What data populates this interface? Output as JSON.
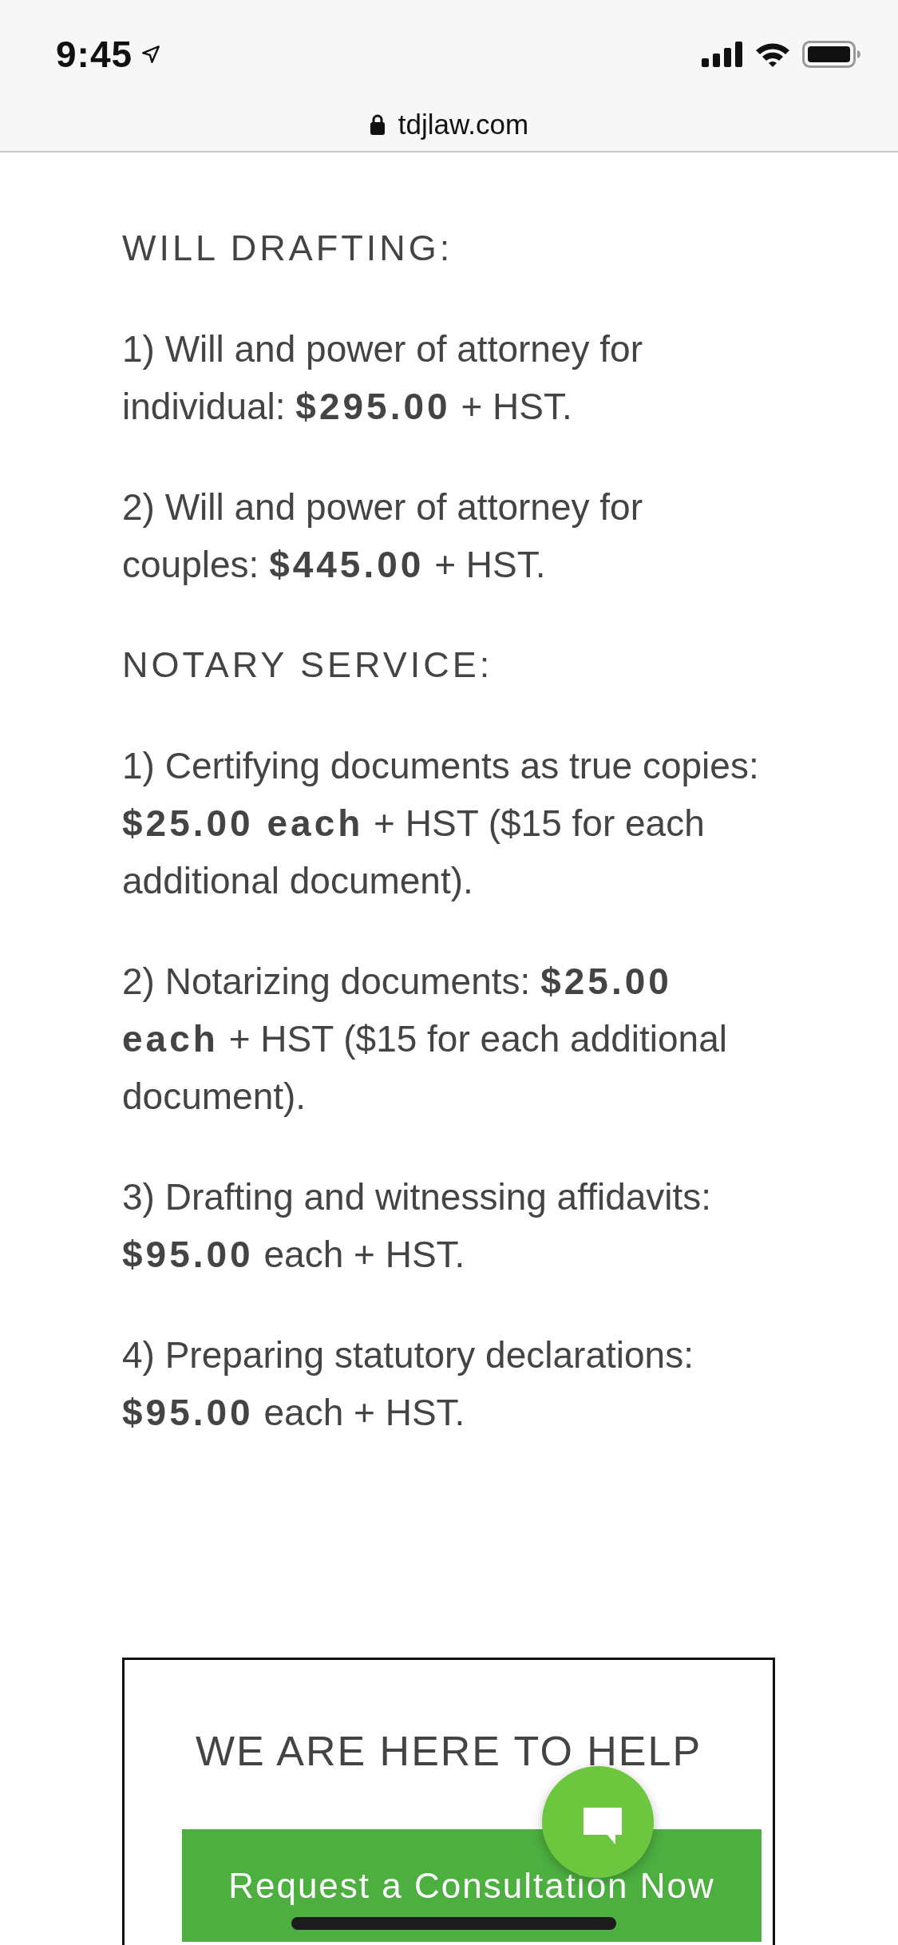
{
  "status_bar": {
    "time": "9:45"
  },
  "browser": {
    "url": "tdjlaw.com",
    "secure": true
  },
  "sections": [
    {
      "heading": "WILL DRAFTING:",
      "items": [
        "1) Will and power of attorney for individual: **$295.00** + HST.",
        "2) Will and power of attorney for couples: **$445.00** + HST."
      ]
    },
    {
      "heading": "NOTARY SERVICE:",
      "items": [
        "1) Certifying documents as true copies: **$25.00 each** + HST ($15 for each additional document).",
        "2) Notarizing documents: **$25.00 each** + HST ($15 for each additional document).",
        "3) Drafting and witnessing affidavits: **$95.00** each + HST.",
        "4) Preparing statutory declarations: **$95.00** each + HST."
      ]
    }
  ],
  "cta": {
    "title": "WE ARE HERE TO HELP",
    "button": "Request a Consultation Now"
  }
}
